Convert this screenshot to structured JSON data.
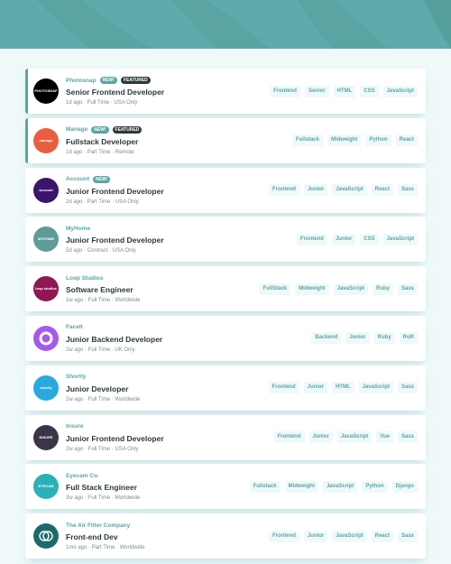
{
  "colors": {
    "primary": "#5ba4a4",
    "dark": "#2c3a3a",
    "background": "#eff9fa",
    "muted": "#7b8e8e"
  },
  "jobs": [
    {
      "company": "Photosnap",
      "logo_text": "PHOTOSNAP",
      "logo_color": "#000000",
      "new": "NEW!",
      "featured": "FEATURED",
      "position": "Senior Frontend Developer",
      "posted": "1d ago",
      "contract": "Full Time",
      "location": "USA Only",
      "tags": [
        "Frontend",
        "Senior",
        "HTML",
        "CSS",
        "JavaScript"
      ]
    },
    {
      "company": "Manage",
      "logo_text": "manage",
      "logo_color": "#ea5e3e",
      "new": "NEW!",
      "featured": "FEATURED",
      "position": "Fullstack Developer",
      "posted": "1d ago",
      "contract": "Part Time",
      "location": "Remote",
      "tags": [
        "Fullstack",
        "Midweight",
        "Python",
        "React"
      ]
    },
    {
      "company": "Account",
      "logo_text": "account",
      "logo_color": "#3d146b",
      "new": "NEW!",
      "featured": null,
      "position": "Junior Frontend Developer",
      "posted": "2d ago",
      "contract": "Part Time",
      "location": "USA Only",
      "tags": [
        "Frontend",
        "Junior",
        "JavaScript",
        "React",
        "Sass"
      ]
    },
    {
      "company": "MyHome",
      "logo_text": "MYHOME",
      "logo_color": "#5f9c99",
      "new": null,
      "featured": null,
      "position": "Junior Frontend Developer",
      "posted": "5d ago",
      "contract": "Contract",
      "location": "USA Only",
      "tags": [
        "Frontend",
        "Junior",
        "CSS",
        "JavaScript"
      ]
    },
    {
      "company": "Loop Studios",
      "logo_text": "loop studios",
      "logo_color": "#8f1755",
      "new": null,
      "featured": null,
      "position": "Software Engineer",
      "posted": "1w ago",
      "contract": "Full Time",
      "location": "Worldwide",
      "tags": [
        "FullStack",
        "Midweight",
        "JavaScript",
        "Ruby",
        "Sass"
      ]
    },
    {
      "company": "FaceIt",
      "logo_text": "",
      "logo_color": "#a559f0",
      "new": null,
      "featured": null,
      "position": "Junior Backend Developer",
      "posted": "2w ago",
      "contract": "Full Time",
      "location": "UK Only",
      "tags": [
        "Backend",
        "Junior",
        "Ruby",
        "RoR"
      ]
    },
    {
      "company": "Shortly",
      "logo_text": "shortly",
      "logo_color": "#2aa8e0",
      "new": null,
      "featured": null,
      "position": "Junior Developer",
      "posted": "2w ago",
      "contract": "Full Time",
      "location": "Worldwide",
      "tags": [
        "Frontend",
        "Junior",
        "HTML",
        "JavaScript",
        "Sass"
      ]
    },
    {
      "company": "Insure",
      "logo_text": "INSURE",
      "logo_color": "#3b3547",
      "new": null,
      "featured": null,
      "position": "Junior Frontend Developer",
      "posted": "2w ago",
      "contract": "Full Time",
      "location": "USA Only",
      "tags": [
        "Frontend",
        "Junior",
        "JavaScript",
        "Vue",
        "Sass"
      ]
    },
    {
      "company": "Eyecam Co.",
      "logo_text": "EYECAM",
      "logo_color": "#2bb0b7",
      "new": null,
      "featured": null,
      "position": "Full Stack Engineer",
      "posted": "3w ago",
      "contract": "Full Time",
      "location": "Worldwide",
      "tags": [
        "Fullstack",
        "Midweight",
        "JavaScript",
        "Python",
        "Django"
      ]
    },
    {
      "company": "The Air Filter Company",
      "logo_text": "",
      "logo_color": "#1e6a6a",
      "new": null,
      "featured": null,
      "position": "Front-end Dev",
      "posted": "1mo ago",
      "contract": "Part Time",
      "location": "Worldwide",
      "tags": [
        "Frontend",
        "Junior",
        "JavaScript",
        "React",
        "Sass"
      ]
    }
  ]
}
